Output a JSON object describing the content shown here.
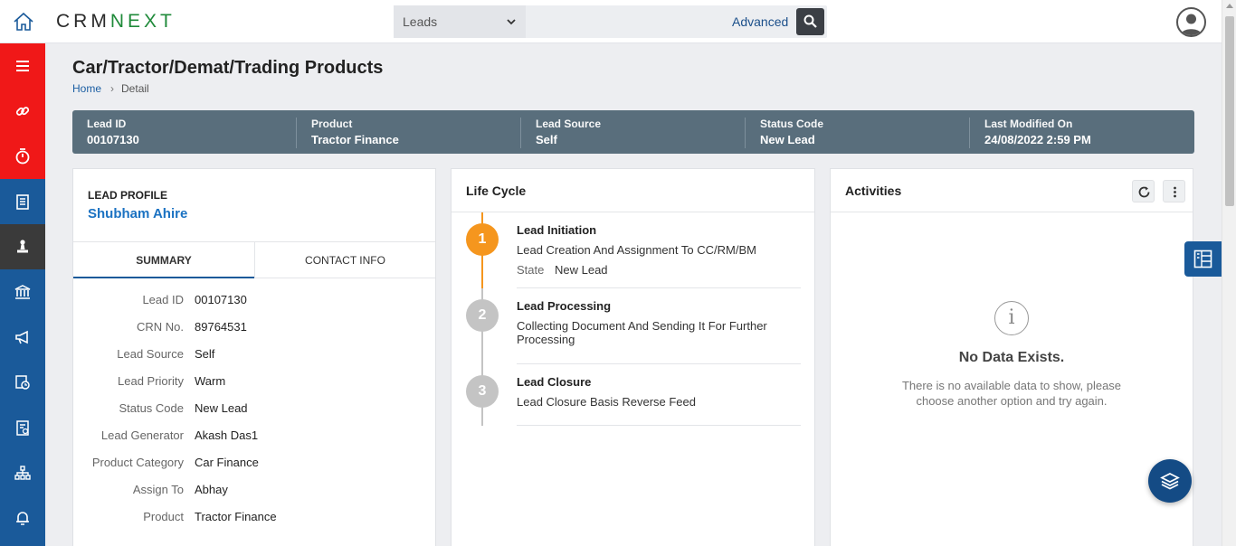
{
  "header": {
    "logo_left": "CRM",
    "logo_right": "NEXT",
    "search_scope": "Leads",
    "advanced_label": "Advanced"
  },
  "page": {
    "title": "Car/Tractor/Demat/Trading Products",
    "breadcrumb_home": "Home",
    "breadcrumb_current": "Detail"
  },
  "strip": [
    {
      "label": "Lead ID",
      "value": "00107130"
    },
    {
      "label": "Product",
      "value": "Tractor Finance"
    },
    {
      "label": "Lead Source",
      "value": "Self"
    },
    {
      "label": "Status Code",
      "value": "New Lead"
    },
    {
      "label": "Last Modified On",
      "value": "24/08/2022 2:59 PM"
    }
  ],
  "profile": {
    "label": "LEAD PROFILE",
    "name": "Shubham Ahire",
    "tabs": [
      "SUMMARY",
      "CONTACT INFO"
    ],
    "summary": [
      {
        "k": "Lead ID",
        "v": "00107130"
      },
      {
        "k": "CRN No.",
        "v": "89764531"
      },
      {
        "k": "Lead Source",
        "v": "Self"
      },
      {
        "k": "Lead Priority",
        "v": "Warm"
      },
      {
        "k": "Status Code",
        "v": "New Lead"
      },
      {
        "k": "Lead Generator",
        "v": "Akash Das1"
      },
      {
        "k": "Product Category",
        "v": "Car Finance"
      },
      {
        "k": "Assign To",
        "v": "Abhay"
      },
      {
        "k": "Product",
        "v": "Tractor Finance"
      }
    ]
  },
  "lifecycle": {
    "title": "Life Cycle",
    "stages": [
      {
        "num": "1",
        "title": "Lead Initiation",
        "desc": "Lead Creation And Assignment To CC/RM/BM",
        "state_label": "State",
        "state_value": "New Lead"
      },
      {
        "num": "2",
        "title": "Lead Processing",
        "desc": "Collecting Document And Sending It For Further Processing"
      },
      {
        "num": "3",
        "title": "Lead Closure",
        "desc": "Lead Closure Basis Reverse Feed"
      }
    ],
    "colors": {
      "active": "#f5961e",
      "inactive": "#c4c4c4"
    }
  },
  "activities": {
    "title": "Activities",
    "info_glyph": "i",
    "empty_title": "No Data Exists.",
    "empty_desc": "There is no available data to show, please choose another option and try again."
  },
  "icons": {
    "nav": [
      "menu-icon",
      "link-icon",
      "stopwatch-icon",
      "document-icon",
      "stamp-icon",
      "bank-icon",
      "megaphone-icon",
      "clock-doc-icon",
      "report-icon",
      "hierarchy-icon",
      "bell-icon"
    ]
  },
  "theme": {
    "nav_blue": "#1a5a9a",
    "nav_red": "#f01818",
    "strip": "#596e7c"
  }
}
